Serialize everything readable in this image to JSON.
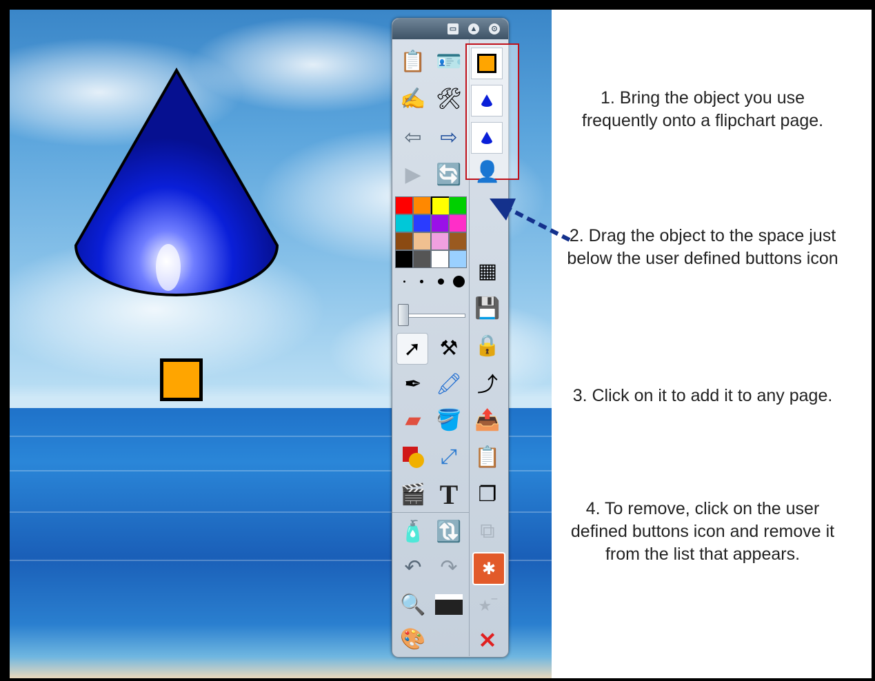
{
  "instructions": {
    "step1": "1. Bring the object you use frequently onto a flipchart page.",
    "step2": "2. Drag the object to the space just below the user defined buttons icon",
    "step3": "3. Click on it to add it to any page.",
    "step4": "4. To remove, click on the user defined buttons icon and remove it from the list that appears."
  },
  "colors": {
    "cone_blue": "#0a1fd8",
    "square_fill": "#ffa500",
    "highlight_red": "#c0101a",
    "arrow_blue": "#14318c"
  },
  "palette": [
    "#ff0000",
    "#ff8800",
    "#ffff00",
    "#00d000",
    "#00c8d8",
    "#2a3cff",
    "#9a10e8",
    "#ff2ec8",
    "#8b4a12",
    "#f0c090",
    "#f0a0e0",
    "#9a5a20",
    "#000000",
    "#555555",
    "#ffffff",
    "#9ad0ff"
  ],
  "toolbar_icons": [
    "flipchart-browser-icon",
    "resource-browser-icon",
    "handwriting-icon",
    "teacher-tools-icon",
    "previous-page-icon",
    "next-page-icon",
    "play-icon",
    "undo-redo-icon",
    "pen-sizes-icon",
    "select-icon",
    "tools-icon",
    "pen-icon",
    "highlighter-icon",
    "eraser-icon",
    "fill-icon",
    "shape-icon",
    "connector-icon",
    "media-icon",
    "text-icon",
    "clear-icon",
    "reset-icon",
    "undo-icon",
    "redo-icon",
    "magnifier-icon",
    "camera-icon",
    "color-picker-icon"
  ],
  "side_icons": [
    "grid-icon",
    "save-icon",
    "lock-icon",
    "export-icon",
    "import-icon",
    "paste-icon",
    "duplicate-icon",
    "group-icon",
    "user-defined-buttons-icon",
    "favorites-icon",
    "close-icon"
  ]
}
